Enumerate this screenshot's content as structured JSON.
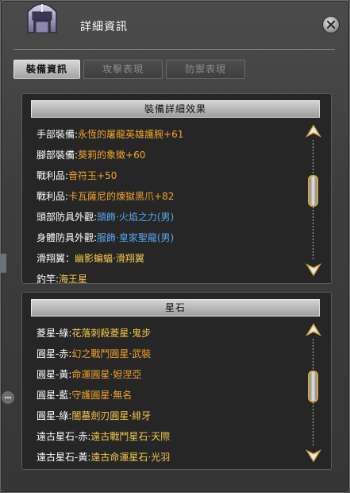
{
  "window": {
    "title": "詳細資訊",
    "close_icon": "close-icon",
    "helmet_icon": "helmet-icon"
  },
  "tabs": [
    {
      "label": "裝備資訊",
      "active": true
    },
    {
      "label": "攻擊表現",
      "active": false
    },
    {
      "label": "防禦表現",
      "active": false
    }
  ],
  "equipment_panel": {
    "header": "裝備詳細效果",
    "rows": [
      {
        "label": "手部裝備:",
        "value": "永恆的屠龍英雄護腕+61",
        "color": "orange"
      },
      {
        "label": "腳部裝備:",
        "value": "葵莉的象徵+60",
        "color": "orange"
      },
      {
        "label": "戰利品:",
        "value": "音符玉+50",
        "color": "orange"
      },
      {
        "label": "戰利品:",
        "value": "卡瓦薩尼的煉獄黑爪+82",
        "color": "orange"
      },
      {
        "label": "頭部防具外觀:",
        "value": "頭飾·火焰之力(男)",
        "color": "blue"
      },
      {
        "label": "身體防具外觀:",
        "value": "服飾·皇家聖龍(男)",
        "color": "blue"
      },
      {
        "label": "滑翔翼：",
        "value": "幽影蝙蝠·滑翔翼",
        "color": "gold"
      },
      {
        "label": "釣竿:",
        "value": "海王星",
        "color": "gold"
      }
    ]
  },
  "star_panel": {
    "header": "星石",
    "rows": [
      {
        "label": "菱星-綠:",
        "value": "花落刺殺菱星·鬼步",
        "color": "gold"
      },
      {
        "label": "圓星-赤:",
        "value": "幻之戰鬥圓星·武裝",
        "color": "orange"
      },
      {
        "label": "圓星-黃:",
        "value": "命運圓星·妲涅亞",
        "color": "orange"
      },
      {
        "label": "圓星-藍:",
        "value": "守護圓星·無名",
        "color": "orange"
      },
      {
        "label": "圓星-綠:",
        "value": "闇墓劍刃圓星·緋牙",
        "color": "gold"
      },
      {
        "label": "遠古星石-赤:",
        "value": "遠古戰鬥星石·天際",
        "color": "gold"
      },
      {
        "label": "遠古星石-黃:",
        "value": "遠古命運星石·光羽",
        "color": "gold"
      }
    ]
  },
  "colors": {
    "orange": "#f0a32a",
    "blue": "#59a6ee",
    "gold": "#f5c84a",
    "scroll_accent": "#d5a943"
  }
}
